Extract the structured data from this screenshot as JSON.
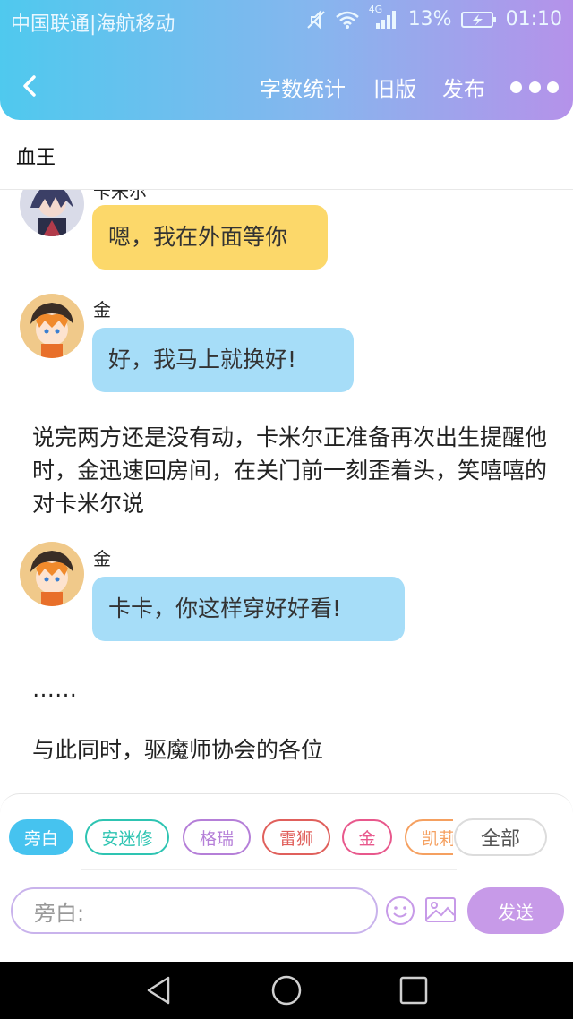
{
  "status_bar": {
    "carrier": "中国联通|海航移动",
    "network": "4G",
    "battery": "13%",
    "time": "01:10"
  },
  "nav": {
    "word_count": "字数统计",
    "old_version": "旧版",
    "publish": "发布"
  },
  "document": {
    "title": "血王"
  },
  "messages": [
    {
      "type": "dialogue",
      "speaker": "卡米尔",
      "text": "嗯，我在外面等你",
      "color": "#fcd86a"
    },
    {
      "type": "dialogue",
      "speaker": "金",
      "text": "好，我马上就换好!",
      "color": "#a6ddf8"
    },
    {
      "type": "narration",
      "text": "说完两方还是没有动，卡米尔正准备再次出生提醒他时，金迅速回房间，在关门前一刻歪着头，笑嘻嘻的对卡米尔说"
    },
    {
      "type": "dialogue",
      "speaker": "金",
      "text": "卡卡，你这样穿好好看!",
      "color": "#a6ddf8"
    },
    {
      "type": "narration",
      "text": "……"
    },
    {
      "type": "narration",
      "text": "与此同时，驱魔师协会的各位"
    }
  ],
  "characters": [
    {
      "label": "旁白",
      "color": "#46c3ef",
      "selected": true
    },
    {
      "label": "安迷修",
      "color": "#2ec4b2",
      "selected": false
    },
    {
      "label": "格瑞",
      "color": "#b57fd8",
      "selected": false
    },
    {
      "label": "雷狮",
      "color": "#e0605c",
      "selected": false
    },
    {
      "label": "金",
      "color": "#e8588c",
      "selected": false
    },
    {
      "label": "凯莉",
      "color": "#f5a060",
      "selected": false
    }
  ],
  "all_chip_label": "全部",
  "input": {
    "placeholder": "旁白:"
  },
  "send_label": "发送",
  "icons": {
    "back": "chevron-left-icon",
    "more": "more-dots-icon",
    "emoji": "smiley-icon",
    "image": "image-icon",
    "sys_back": "triangle-back-icon",
    "sys_home": "circle-home-icon",
    "sys_recent": "square-recent-icon"
  },
  "colors": {
    "header_start": "#4fc9ee",
    "header_end": "#b592ea",
    "send_button": "#c79ae8"
  }
}
